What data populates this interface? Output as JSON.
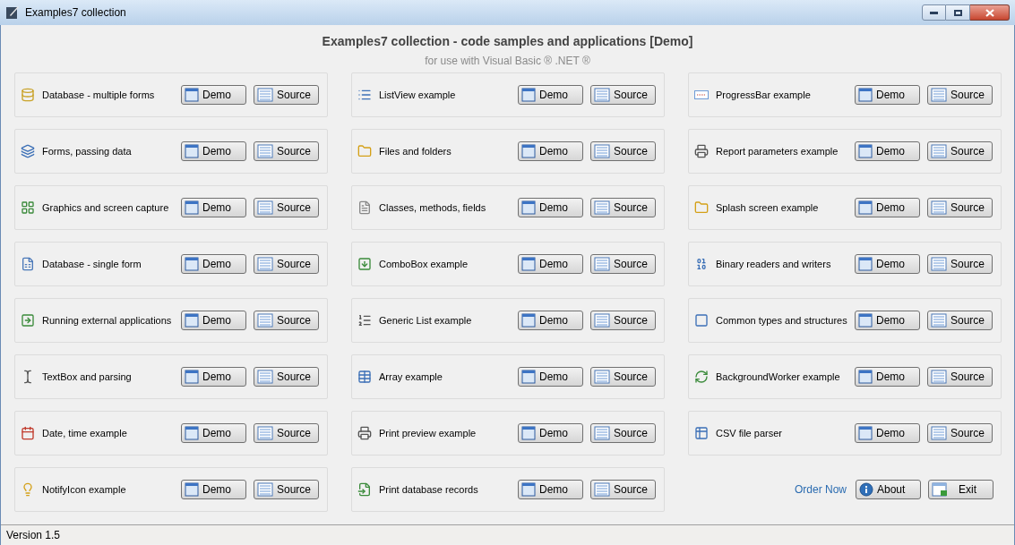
{
  "window": {
    "title": "Examples7 collection"
  },
  "header": {
    "title": "Examples7 collection - code samples and applications [Demo]",
    "subtitle": "for use with Visual Basic ® .NET ®"
  },
  "columns": [
    {
      "examples": [
        {
          "label": "Database - multiple forms",
          "buttons": [
            "Demo",
            "Source"
          ]
        },
        {
          "label": "Forms, passing data",
          "buttons": [
            "Demo",
            "Source"
          ]
        },
        {
          "label": "Graphics and screen capture",
          "buttons": [
            "Demo",
            "Source"
          ]
        },
        {
          "label": "Database - single form",
          "buttons": [
            "Demo",
            "Source"
          ]
        },
        {
          "label": "Running external applications",
          "buttons": [
            "Demo",
            "Source"
          ]
        },
        {
          "label": "TextBox and parsing",
          "buttons": [
            "Demo",
            "Source"
          ]
        },
        {
          "label": "Date, time example",
          "buttons": [
            "Demo",
            "Source"
          ]
        },
        {
          "label": "NotifyIcon example",
          "buttons": [
            "Demo",
            "Source"
          ]
        }
      ]
    },
    {
      "examples": [
        {
          "label": "ListView example",
          "buttons": [
            "Demo",
            "Source"
          ]
        },
        {
          "label": "Files and folders",
          "buttons": [
            "Demo",
            "Source"
          ]
        },
        {
          "label": "Classes, methods, fields",
          "buttons": [
            "Demo",
            "Source"
          ]
        },
        {
          "label": "ComboBox example",
          "buttons": [
            "Demo",
            "Source"
          ]
        },
        {
          "label": "Generic List example",
          "buttons": [
            "Demo",
            "Source"
          ]
        },
        {
          "label": "Array example",
          "buttons": [
            "Demo",
            "Source"
          ]
        },
        {
          "label": "Print preview example",
          "buttons": [
            "Demo",
            "Source"
          ]
        },
        {
          "label": "Print database records",
          "buttons": [
            "Demo",
            "Source"
          ]
        }
      ]
    },
    {
      "examples": [
        {
          "label": "ProgressBar example",
          "buttons": [
            "Demo",
            "Source"
          ]
        },
        {
          "label": "Report parameters example",
          "buttons": [
            "Demo",
            "Source"
          ]
        },
        {
          "label": "Splash screen example",
          "buttons": [
            "Demo",
            "Source"
          ]
        },
        {
          "label": "Binary readers and writers",
          "buttons": [
            "Demo",
            "Source"
          ]
        },
        {
          "label": "Common types and structures",
          "buttons": [
            "Demo",
            "Source"
          ]
        },
        {
          "label": "BackgroundWorker example",
          "buttons": [
            "Demo",
            "Source"
          ]
        },
        {
          "label": "CSV file parser",
          "buttons": [
            "Demo",
            "Source"
          ]
        }
      ]
    }
  ],
  "footer": {
    "link": "Order Now",
    "buttons": [
      "About",
      "Exit"
    ]
  },
  "status_bar": {
    "text": "Version 1.5"
  }
}
